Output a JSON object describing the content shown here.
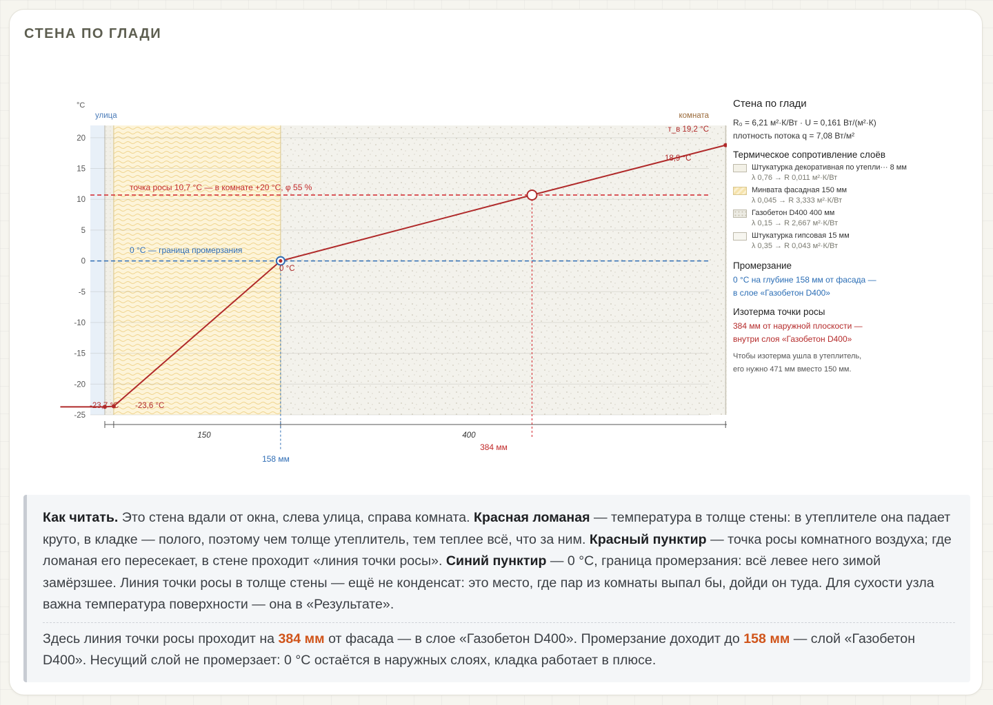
{
  "page": {
    "title": "СТЕНА ПО ГЛАДИ"
  },
  "chart_data": {
    "type": "line",
    "title": "Стена по глади",
    "y_unit": "°C",
    "ylim": [
      -25,
      22
    ],
    "yticks": [
      20,
      15,
      10,
      5,
      0,
      -5,
      -10,
      -15,
      -20,
      -25
    ],
    "x_unit": "мм",
    "xlim": [
      -13,
      543
    ],
    "side_labels": {
      "left": "улица",
      "right": "комната"
    },
    "layers": [
      {
        "name": "Штукатурка декоративная по утеплителю",
        "thickness_mm": 8
      },
      {
        "name": "Минвата фасадная",
        "thickness_mm": 150
      },
      {
        "name": "Газобетон D400",
        "thickness_mm": 400
      },
      {
        "name": "Штукатурка гипсовая",
        "thickness_mm": 15
      }
    ],
    "series": [
      {
        "color": "#b02a2a",
        "x": [
          -40,
          0,
          8,
          158,
          384,
          558,
          573,
          613
        ],
        "y": [
          -23.7,
          -23.7,
          -23.6,
          0,
          10.7,
          18.8,
          18.9,
          19.8
        ]
      }
    ],
    "dim_labels": [
      "150",
      "400"
    ],
    "dew_line": {
      "y": 10.7,
      "color": "#d2232a",
      "label": "точка росы 10,7 °C — в комнате +20 °C, φ 55 %"
    },
    "freeze_line": {
      "y": 0,
      "color": "#2f6db5",
      "label": "0 °C — граница промерзания"
    },
    "freeze_point": {
      "x": 158,
      "label": "158 мм",
      "point_label": "0 °C"
    },
    "dew_point": {
      "x": 384,
      "label": "384 мм"
    },
    "labels": {
      "outside_air": "-23,7 °C",
      "outer_surface": "-23,6 °C",
      "inner_surface": "18,9 °C",
      "inside_air": "т_в 19,2 °C"
    }
  },
  "legend": {
    "title": "Стена по глади",
    "r_line": "R₀ = 6,21 м²·К/Вт · U = 0,161 Вт/(м²·К)",
    "q_line": "плотность потока q = 7,08 Вт/м²",
    "layers_title": "Термическое сопротивление слоёв",
    "layers": [
      {
        "name": "Штукатурка декоративная по утепли··· 8 мм",
        "sub": "λ 0,76 → R 0,011 м²·К/Вт"
      },
      {
        "name": "Минвата фасадная 150 мм",
        "sub": "λ 0,045 → R 3,333 м²·К/Вт"
      },
      {
        "name": "Газобетон D400 400 мм",
        "sub": "λ 0,15 → R 2,667 м²·К/Вт"
      },
      {
        "name": "Штукатурка гипсовая 15 мм",
        "sub": "λ 0,35 → R 0,043 м²·К/Вт"
      }
    ],
    "freeze_title": "Промерзание",
    "freeze_l1": "0 °C на глубине 158 мм от фасада —",
    "freeze_l2": "в слое «Газобетон D400»",
    "dew_title": "Изотерма точки росы",
    "dew_l1": "384 мм от наружной плоскости —",
    "dew_l2": "внутри слоя «Газобетон D400»",
    "note_l1": "Чтобы изотерма ушла в утеплитель,",
    "note_l2": "его нужно 471 мм вместо 150 мм."
  },
  "explain": {
    "lead": "Как читать.",
    "t1": " Это стена вдали от окна, слева улица, справа комната. ",
    "b1": "Красная ломаная",
    "t2": " — температура в толще стены: в утеплителе она падает круто, в кладке — полого, поэтому чем толще утеплитель, тем теплее всё, что за ним. ",
    "b2": "Красный пунктир",
    "t3": " — точка росы комнатного воздуха; где ломаная его пересекает, в стене проходит «линия точки росы». ",
    "b3": "Синий пунктир",
    "t4": " — 0 °C, граница промерзания: всё левее него зимой замёрзшее. Линия точки росы в толще стены — ещё не конденсат: это место, где пар из комнаты выпал бы, дойди он туда. Для сухости узла важна температура поверхности — она в «Результате».",
    "s1": "Здесь линия точки росы проходит на ",
    "h1": "384 мм",
    "s2": " от фасада — в слое «Газобетон D400». Промерзание доходит до ",
    "h2": "158 мм",
    "s3": " — слой «Газобетон D400». Несущий слой не промерзает: 0 °C остаётся в наружных слоях, кладка работает в плюсе."
  }
}
